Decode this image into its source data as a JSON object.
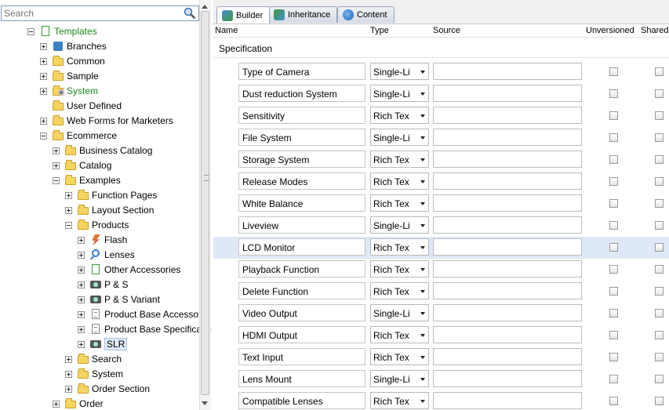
{
  "search": {
    "placeholder": "Search"
  },
  "tree": [
    {
      "label": "Templates",
      "icon": "document-icon",
      "exp": "minus",
      "indent": 0,
      "green": true
    },
    {
      "label": "Branches",
      "icon": "branch-icon",
      "exp": "plus",
      "indent": 1
    },
    {
      "label": "Common",
      "icon": "folder-icon",
      "exp": "plus",
      "indent": 1
    },
    {
      "label": "Sample",
      "icon": "folder-icon",
      "exp": "plus",
      "indent": 1
    },
    {
      "label": "System",
      "icon": "system-folder-icon",
      "exp": "plus",
      "indent": 1,
      "green": true
    },
    {
      "label": "User Defined",
      "icon": "folder-icon",
      "exp": "none",
      "indent": 1
    },
    {
      "label": "Web Forms for Marketers",
      "icon": "folder-icon",
      "exp": "plus",
      "indent": 1
    },
    {
      "label": "Ecommerce",
      "icon": "folder-icon",
      "exp": "minus",
      "indent": 1
    },
    {
      "label": "Business Catalog",
      "icon": "folder-icon",
      "exp": "plus",
      "indent": 2
    },
    {
      "label": "Catalog",
      "icon": "folder-icon",
      "exp": "plus",
      "indent": 2
    },
    {
      "label": "Examples",
      "icon": "folder-icon",
      "exp": "minus",
      "indent": 2
    },
    {
      "label": "Function Pages",
      "icon": "folder-icon",
      "exp": "plus",
      "indent": 3
    },
    {
      "label": "Layout Section",
      "icon": "folder-icon",
      "exp": "plus",
      "indent": 3
    },
    {
      "label": "Products",
      "icon": "folder-icon",
      "exp": "minus",
      "indent": 3
    },
    {
      "label": "Flash",
      "icon": "flash-icon",
      "exp": "plus",
      "indent": 4
    },
    {
      "label": "Lenses",
      "icon": "lens-icon",
      "exp": "plus",
      "indent": 4
    },
    {
      "label": "Other Accessories",
      "icon": "template-icon",
      "exp": "plus",
      "indent": 4
    },
    {
      "label": "P & S",
      "icon": "camera-icon",
      "exp": "plus",
      "indent": 4
    },
    {
      "label": "P & S Variant",
      "icon": "camera-icon",
      "exp": "plus",
      "indent": 4
    },
    {
      "label": "Product Base Accessorie",
      "icon": "list-document-icon",
      "exp": "plus",
      "indent": 4
    },
    {
      "label": "Product Base Specificatio",
      "icon": "list-document-icon",
      "exp": "plus",
      "indent": 4
    },
    {
      "label": "SLR",
      "icon": "slr-camera-icon",
      "exp": "plus",
      "indent": 4,
      "selected": true
    },
    {
      "label": "Search",
      "icon": "folder-icon",
      "exp": "plus",
      "indent": 3
    },
    {
      "label": "System",
      "icon": "folder-icon",
      "exp": "plus",
      "indent": 3
    },
    {
      "label": "Order Section",
      "icon": "folder-icon",
      "exp": "plus",
      "indent": 3
    },
    {
      "label": "Order",
      "icon": "folder-icon",
      "exp": "plus",
      "indent": 2
    }
  ],
  "tabs": [
    {
      "label": "Builder",
      "icon": "builder-icon",
      "active": true
    },
    {
      "label": "Inheritance",
      "icon": "inheritance-icon",
      "active": false
    },
    {
      "label": "Content",
      "icon": "content-icon",
      "active": false
    }
  ],
  "columns": {
    "name": "Name",
    "type": "Type",
    "source": "Source",
    "unversioned": "Unversioned",
    "shared": "Shared"
  },
  "section": {
    "name": "Specification"
  },
  "fields": [
    {
      "name": "Type of Camera",
      "type": "Single-Li",
      "source": "",
      "highlighted": false
    },
    {
      "name": "Dust reduction System",
      "type": "Single-Li",
      "source": "",
      "highlighted": false
    },
    {
      "name": "Sensitivity",
      "type": "Rich Tex",
      "source": "",
      "highlighted": false
    },
    {
      "name": "File System",
      "type": "Single-Li",
      "source": "",
      "highlighted": false
    },
    {
      "name": "Storage System",
      "type": "Rich Tex",
      "source": "",
      "highlighted": false
    },
    {
      "name": "Release Modes",
      "type": "Rich Tex",
      "source": "",
      "highlighted": false
    },
    {
      "name": "White Balance",
      "type": "Rich Tex",
      "source": "",
      "highlighted": false
    },
    {
      "name": "Liveview",
      "type": "Single-Li",
      "source": "",
      "highlighted": false
    },
    {
      "name": "LCD Monitor",
      "type": "Rich Tex",
      "source": "",
      "highlighted": true
    },
    {
      "name": "Playback Function",
      "type": "Rich Tex",
      "source": "",
      "highlighted": false
    },
    {
      "name": "Delete Function",
      "type": "Rich Tex",
      "source": "",
      "highlighted": false
    },
    {
      "name": "Video Output",
      "type": "Single-Li",
      "source": "",
      "highlighted": false
    },
    {
      "name": "HDMI Output",
      "type": "Rich Tex",
      "source": "",
      "highlighted": false
    },
    {
      "name": "Text Input",
      "type": "Rich Tex",
      "source": "",
      "highlighted": false
    },
    {
      "name": "Lens Mount",
      "type": "Single-Li",
      "source": "",
      "highlighted": false
    },
    {
      "name": "Compatible Lenses",
      "type": "Rich Tex",
      "source": "",
      "highlighted": false
    }
  ],
  "colors": {
    "highlight_row": "#dfe8f6",
    "green_text": "#1a8a1a",
    "folder": "#f7d45f"
  }
}
